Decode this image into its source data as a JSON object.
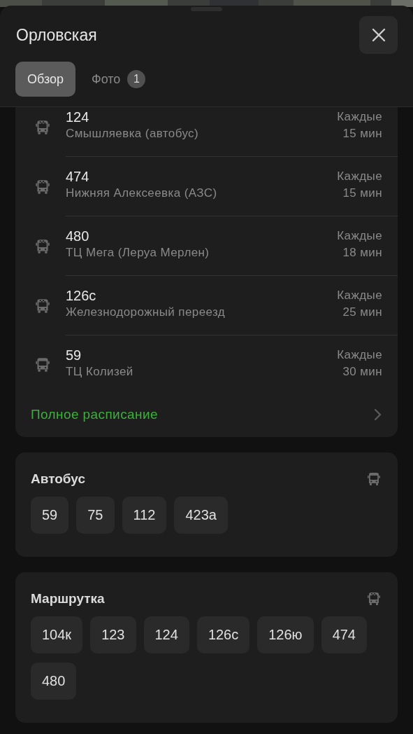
{
  "sheet": {
    "title": "Орловская",
    "tabs": [
      {
        "label": "Обзор",
        "selected": true
      },
      {
        "label": "Фото",
        "selected": false,
        "badge": "1"
      }
    ]
  },
  "schedule": {
    "rows": [
      {
        "kind": "minibus",
        "route": "124",
        "destination": "Смышляевка (автобус)",
        "interval_label": "Каждые",
        "interval": "15 мин"
      },
      {
        "kind": "minibus",
        "route": "474",
        "destination": "Нижняя Алексеевка (АЗС)",
        "interval_label": "Каждые",
        "interval": "15 мин"
      },
      {
        "kind": "minibus",
        "route": "480",
        "destination": "ТЦ Мега (Леруа Мерлен)",
        "interval_label": "Каждые",
        "interval": "18 мин"
      },
      {
        "kind": "minibus",
        "route": "126с",
        "destination": "Железнодорожный переезд",
        "interval_label": "Каждые",
        "interval": "25 мин"
      },
      {
        "kind": "bus",
        "route": "59",
        "destination": "ТЦ Колизей",
        "interval_label": "Каждые",
        "interval": "30 мин"
      }
    ],
    "link": "Полное расписание"
  },
  "groups": [
    {
      "title": "Автобус",
      "kind": "bus",
      "routes": [
        "59",
        "75",
        "112",
        "423а"
      ]
    },
    {
      "title": "Маршрутка",
      "kind": "minibus",
      "routes": [
        "104к",
        "123",
        "124",
        "126с",
        "126ю",
        "474",
        "480"
      ]
    }
  ]
}
